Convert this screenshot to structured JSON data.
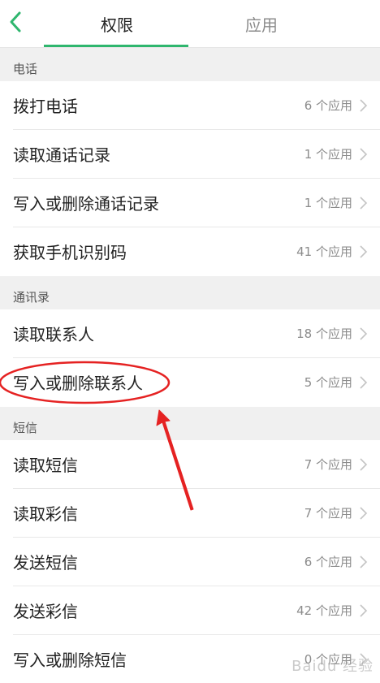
{
  "tabs": {
    "permissions": "权限",
    "apps": "应用"
  },
  "colors": {
    "accent": "#2fb66e",
    "annotation": "#e52222"
  },
  "sections": [
    {
      "title": "电话",
      "items": [
        {
          "label": "拨打电话",
          "count": "6 个应用"
        },
        {
          "label": "读取通话记录",
          "count": "1 个应用"
        },
        {
          "label": "写入或删除通话记录",
          "count": "1 个应用"
        },
        {
          "label": "获取手机识别码",
          "count": "41 个应用"
        }
      ]
    },
    {
      "title": "通讯录",
      "items": [
        {
          "label": "读取联系人",
          "count": "18 个应用"
        },
        {
          "label": "写入或删除联系人",
          "count": "5 个应用"
        }
      ]
    },
    {
      "title": "短信",
      "items": [
        {
          "label": "读取短信",
          "count": "7 个应用"
        },
        {
          "label": "读取彩信",
          "count": "7 个应用"
        },
        {
          "label": "发送短信",
          "count": "6 个应用"
        },
        {
          "label": "发送彩信",
          "count": "42 个应用"
        },
        {
          "label": "写入或删除短信",
          "count": "0 个应用"
        }
      ]
    }
  ],
  "icons": {
    "back": "chevron-left-icon",
    "row": "chevron-right-icon"
  }
}
